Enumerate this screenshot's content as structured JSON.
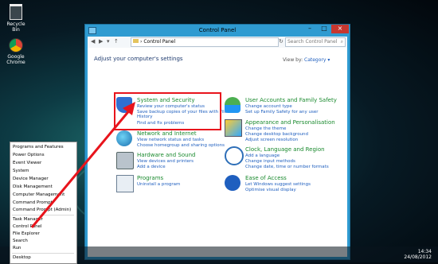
{
  "desktop": {
    "icons": [
      {
        "label": "Recycle Bin",
        "icon": "recycle-bin-icon"
      },
      {
        "label": "Google Chrome",
        "icon": "chrome-icon"
      }
    ]
  },
  "window": {
    "title": "Control Panel",
    "address": "Control Panel",
    "search_placeholder": "Search Control Panel",
    "heading": "Adjust your computer's settings",
    "view_by_label": "View by:",
    "view_by_value": "Category",
    "categories": [
      {
        "title": "System and Security",
        "links": [
          "Review your computer's status",
          "Save backup copies of your files with File",
          "History",
          "Find and fix problems"
        ],
        "icon": "shield-icon"
      },
      {
        "title": "Network and Internet",
        "links": [
          "View network status and tasks",
          "Choose homegroup and sharing options"
        ],
        "icon": "network-icon"
      },
      {
        "title": "Hardware and Sound",
        "links": [
          "View devices and printers",
          "Add a device"
        ],
        "icon": "printer-icon"
      },
      {
        "title": "Programs",
        "links": [
          "Uninstall a program"
        ],
        "icon": "programs-icon"
      },
      {
        "title": "User Accounts and Family Safety",
        "links": [
          "Change account type",
          "Set up Family Safety for any user"
        ],
        "icon": "users-icon"
      },
      {
        "title": "Appearance and Personalisation",
        "links": [
          "Change the theme",
          "Change desktop background",
          "Adjust screen resolution"
        ],
        "icon": "appearance-icon"
      },
      {
        "title": "Clock, Language and Region",
        "links": [
          "Add a language",
          "Change input methods",
          "Change date, time or number formats"
        ],
        "icon": "clock-icon"
      },
      {
        "title": "Ease of Access",
        "links": [
          "Let Windows suggest settings",
          "Optimise visual display"
        ],
        "icon": "ease-of-access-icon"
      }
    ]
  },
  "menu": {
    "items": [
      "Programs and Features",
      "Power Options",
      "Event Viewer",
      "System",
      "Device Manager",
      "Disk Management",
      "Computer Management",
      "Command Prompt",
      "Command Prompt (Admin)",
      "Task Manager",
      "Control Panel",
      "File Explorer",
      "Search",
      "Run",
      "Desktop"
    ]
  },
  "taskbar": {
    "time": "14:34",
    "date": "24/08/2012"
  },
  "colors": {
    "highlight": "#e8141c",
    "category_title": "#1a8a2e",
    "link": "#1f5fbf",
    "window_frame": "#2f9bd1"
  }
}
